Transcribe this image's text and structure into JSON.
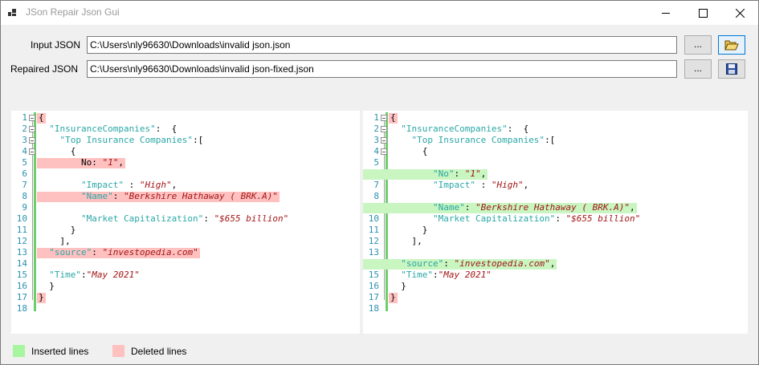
{
  "window": {
    "title": "JSon Repair Json Gui"
  },
  "form": {
    "input_label": "Input JSON",
    "input_value": "C:\\Users\\nly96630\\Downloads\\invalid json.json",
    "repaired_label": "Repaired JSON",
    "repaired_value": "C:\\Users\\nly96630\\Downloads\\invalid json-fixed.json",
    "browse_label": "...",
    "browse2_label": "..."
  },
  "icons": {
    "open": "folder-open-icon",
    "save": "floppy-disk-icon"
  },
  "colors": {
    "inserted": "#a8f5a0",
    "deleted": "#ffc0c0",
    "key": "#2aa6a6",
    "string": "#a31515",
    "line_number": "#2b91af"
  },
  "left_editor": {
    "line_numbers": [
      "1",
      "2",
      "3",
      "4",
      "5",
      "6",
      "7",
      "8",
      "9",
      "10",
      "11",
      "12",
      "13",
      "14",
      "15",
      "16",
      "17",
      "18"
    ],
    "lines": [
      {
        "n": 1,
        "hl": "del",
        "parts": [
          {
            "t": "p",
            "v": "{"
          }
        ]
      },
      {
        "n": 2,
        "parts": [
          {
            "t": "k",
            "v": "  \"InsuranceCompanies\""
          },
          {
            "t": "p",
            "v": ":  {"
          }
        ]
      },
      {
        "n": 3,
        "parts": [
          {
            "t": "k",
            "v": "    \"Top Insurance Companies\""
          },
          {
            "t": "p",
            "v": ":["
          }
        ]
      },
      {
        "n": 4,
        "parts": [
          {
            "t": "p",
            "v": "      {"
          }
        ]
      },
      {
        "n": 5,
        "hl": "del",
        "parts": [
          {
            "t": "p",
            "v": "        No: "
          },
          {
            "t": "s",
            "v": "\"1\""
          },
          {
            "t": "p",
            "v": ","
          }
        ]
      },
      {
        "n": 6,
        "parts": []
      },
      {
        "n": 7,
        "parts": [
          {
            "t": "k",
            "v": "        \"Impact\""
          },
          {
            "t": "p",
            "v": " : "
          },
          {
            "t": "s",
            "v": "\"High\""
          },
          {
            "t": "p",
            "v": ","
          }
        ]
      },
      {
        "n": 8,
        "hl": "del",
        "parts": [
          {
            "t": "k",
            "v": "        \"Name\""
          },
          {
            "t": "p",
            "v": ": "
          },
          {
            "t": "s",
            "v": "\"Berkshire Hathaway ( BRK.A)\""
          }
        ]
      },
      {
        "n": 9,
        "parts": []
      },
      {
        "n": 10,
        "parts": [
          {
            "t": "k",
            "v": "        \"Market Capitalization\""
          },
          {
            "t": "p",
            "v": ": "
          },
          {
            "t": "s",
            "v": "\"$655 billion\""
          }
        ]
      },
      {
        "n": 11,
        "parts": [
          {
            "t": "p",
            "v": "      }"
          }
        ]
      },
      {
        "n": 12,
        "parts": [
          {
            "t": "p",
            "v": "    ],"
          }
        ]
      },
      {
        "n": 13,
        "hl": "del",
        "parts": [
          {
            "t": "k",
            "v": "  \"source\""
          },
          {
            "t": "p",
            "v": ": "
          },
          {
            "t": "s",
            "v": "\"investopedia.com\""
          }
        ]
      },
      {
        "n": 14,
        "parts": []
      },
      {
        "n": 15,
        "parts": [
          {
            "t": "k",
            "v": "  \"Time\""
          },
          {
            "t": "p",
            "v": ":"
          },
          {
            "t": "s",
            "v": "\"May 2021\""
          }
        ]
      },
      {
        "n": 16,
        "parts": [
          {
            "t": "p",
            "v": "  }"
          }
        ]
      },
      {
        "n": 17,
        "hl": "del",
        "parts": [
          {
            "t": "p",
            "v": "}"
          }
        ]
      },
      {
        "n": 18,
        "parts": []
      }
    ]
  },
  "right_editor": {
    "line_numbers": [
      "1",
      "2",
      "3",
      "4",
      "5",
      "6",
      "7",
      "8",
      "9",
      "10",
      "11",
      "12",
      "13",
      "14",
      "15",
      "16",
      "17",
      "18"
    ],
    "lines": [
      {
        "n": 1,
        "hl": "del",
        "parts": [
          {
            "t": "p",
            "v": "{"
          }
        ]
      },
      {
        "n": 2,
        "parts": [
          {
            "t": "k",
            "v": "  \"InsuranceCompanies\""
          },
          {
            "t": "p",
            "v": ":  {"
          }
        ]
      },
      {
        "n": 3,
        "parts": [
          {
            "t": "k",
            "v": "    \"Top Insurance Companies\""
          },
          {
            "t": "p",
            "v": ":["
          }
        ]
      },
      {
        "n": 4,
        "parts": [
          {
            "t": "p",
            "v": "      {"
          }
        ]
      },
      {
        "n": 5,
        "parts": []
      },
      {
        "n": 6,
        "hl": "ins",
        "parts": [
          {
            "t": "k",
            "v": "        \"No\""
          },
          {
            "t": "p",
            "v": ": "
          },
          {
            "t": "s",
            "v": "\"1\""
          },
          {
            "t": "p",
            "v": ","
          }
        ]
      },
      {
        "n": 7,
        "parts": [
          {
            "t": "k",
            "v": "        \"Impact\""
          },
          {
            "t": "p",
            "v": " : "
          },
          {
            "t": "s",
            "v": "\"High\""
          },
          {
            "t": "p",
            "v": ","
          }
        ]
      },
      {
        "n": 8,
        "parts": []
      },
      {
        "n": 9,
        "hl": "ins",
        "parts": [
          {
            "t": "k",
            "v": "        \"Name\""
          },
          {
            "t": "p",
            "v": ": "
          },
          {
            "t": "s",
            "v": "\"Berkshire Hathaway ( BRK.A)\""
          },
          {
            "t": "p",
            "v": ","
          }
        ]
      },
      {
        "n": 10,
        "parts": [
          {
            "t": "k",
            "v": "        \"Market Capitalization\""
          },
          {
            "t": "p",
            "v": ": "
          },
          {
            "t": "s",
            "v": "\"$655 billion\""
          }
        ]
      },
      {
        "n": 11,
        "parts": [
          {
            "t": "p",
            "v": "      }"
          }
        ]
      },
      {
        "n": 12,
        "parts": [
          {
            "t": "p",
            "v": "    ],"
          }
        ]
      },
      {
        "n": 13,
        "parts": []
      },
      {
        "n": 14,
        "hl": "ins",
        "parts": [
          {
            "t": "k",
            "v": "  \"source\""
          },
          {
            "t": "p",
            "v": ": "
          },
          {
            "t": "s",
            "v": "\"investopedia.com\""
          },
          {
            "t": "p",
            "v": ","
          }
        ]
      },
      {
        "n": 15,
        "parts": [
          {
            "t": "k",
            "v": "  \"Time\""
          },
          {
            "t": "p",
            "v": ":"
          },
          {
            "t": "s",
            "v": "\"May 2021\""
          }
        ]
      },
      {
        "n": 16,
        "parts": [
          {
            "t": "p",
            "v": "  }"
          }
        ]
      },
      {
        "n": 17,
        "hl": "del",
        "parts": [
          {
            "t": "p",
            "v": "}"
          }
        ]
      },
      {
        "n": 18,
        "parts": []
      }
    ]
  },
  "legend": {
    "inserted_label": "Inserted lines",
    "deleted_label": "Deleted lines"
  }
}
